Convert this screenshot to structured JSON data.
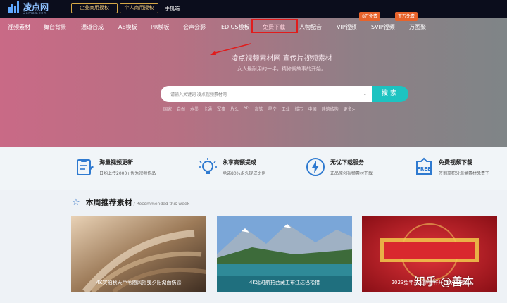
{
  "topbar": {
    "logo_text": "凌点网",
    "logo_sub": "2amaa.com",
    "auth_enterprise": "企业商用授权",
    "auth_personal": "个人商用授权",
    "mobile": "手机端"
  },
  "nav": {
    "items": [
      "视频素材",
      "舞台背景",
      "通道合成",
      "AE模板",
      "PR模板",
      "会声会影",
      "EDIUS模板",
      "免费下载",
      "人物配音",
      "VIP视频",
      "SVIP视频",
      "万图聚"
    ],
    "active_index": 7,
    "badge_vip": "8万免费",
    "badge_svip": "百万免费"
  },
  "hero": {
    "slogan": "凌点视频素材网  宣传片视频素材",
    "subslogan": "女人最耐用的一半，精修就故事的开始。",
    "search_placeholder": "请输入关键词  凌点视频素材网",
    "search_button": "搜索",
    "hot_tags": [
      "国家",
      "自然",
      "水墨",
      "卡通",
      "军事",
      "片头",
      "5G",
      "高铁",
      "星空",
      "工业",
      "城市",
      "中国",
      "建筑结构",
      "更多>"
    ]
  },
  "features": [
    {
      "title": "海量视频更新",
      "desc": "日均上传2000+优秀视频作品",
      "icon": "clipboard-icon"
    },
    {
      "title": "永享高额提成",
      "desc": "承诺80%永久提成比例",
      "icon": "lightbulb-icon"
    },
    {
      "title": "无忧下载服务",
      "desc": "正品原创视频素材下载",
      "icon": "lightning-icon"
    },
    {
      "title": "免费视频下载",
      "desc": "签到拿积分海量素材免费下",
      "icon": "free-tag-icon"
    }
  ],
  "recommend": {
    "title": "本周推荐素材",
    "subtitle": "/ Recommended this week",
    "cards": [
      {
        "caption": "4K实拍秋天芦苇随风摇曳夕阳湖面伤感"
      },
      {
        "caption": "4K延时航拍西藏工布江达巴松措"
      },
      {
        "caption": "2023兔年元宵节吉祥开场片头视频"
      }
    ]
  },
  "watermark": "知乎 @善本",
  "colors": {
    "accent_teal": "#1dc3c1",
    "highlight_red": "#e11c1c",
    "badge_orange": "#e8632b",
    "gold": "#d7a946"
  }
}
